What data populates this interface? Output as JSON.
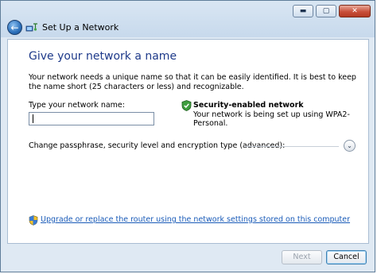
{
  "window": {
    "title": "Set Up a Network",
    "controls": {
      "minimize": "▬",
      "maximize": "▢",
      "close": "✕"
    }
  },
  "content": {
    "heading": "Give your network a name",
    "description": "Your network needs a unique name so that it can be easily identified. It is best to keep the name short (25 characters or less) and recognizable.",
    "name_label": "Type your network name:",
    "name_value": "",
    "security_title": "Security-enabled network",
    "security_detail": "Your network is being set up using WPA2-Personal.",
    "advanced_label": "Change passphrase, security level and encryption type (advanced):",
    "router_link": "Upgrade or replace the router using the network settings stored on this computer"
  },
  "footer": {
    "next_label": "Next",
    "cancel_label": "Cancel"
  },
  "icons": {
    "back": "back-arrow-icon",
    "network": "network-setup-icon",
    "security": "shield-check-icon",
    "expand": "chevron-down-icon",
    "uac": "uac-shield-icon"
  },
  "colors": {
    "heading": "#1e3a8a",
    "link": "#1a5bb8",
    "chrome": "#dfe9f3"
  }
}
